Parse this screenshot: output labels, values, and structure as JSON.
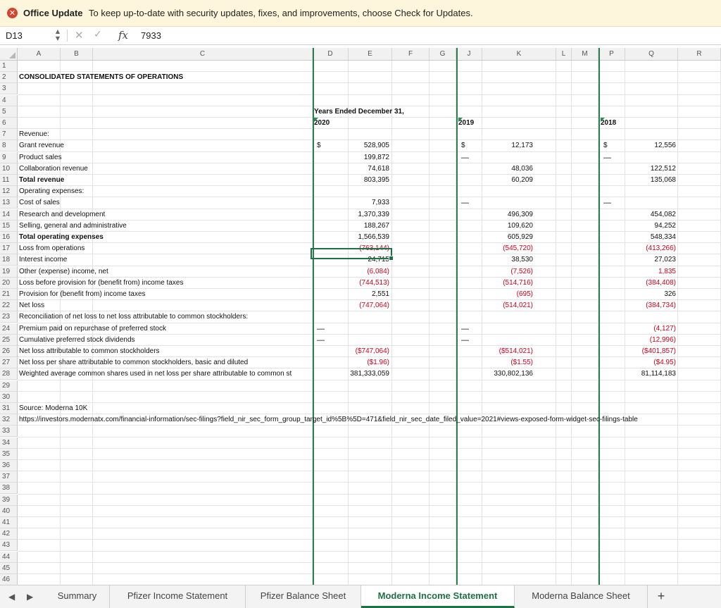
{
  "notification": {
    "title": "Office Update",
    "message": "To keep up-to-date with security updates, fixes, and improvements, choose Check for Updates."
  },
  "formula_bar": {
    "name_box": "D13",
    "fx": "fx",
    "value": "7933"
  },
  "columns": [
    "A",
    "B",
    "C",
    "D",
    "E",
    "F",
    "G",
    "J",
    "K",
    "L",
    "M",
    "P",
    "Q",
    "R"
  ],
  "rows": [
    "1",
    "2",
    "3",
    "4",
    "5",
    "6",
    "7",
    "8",
    "9",
    "10",
    "11",
    "12",
    "13",
    "14",
    "15",
    "16",
    "17",
    "18",
    "19",
    "20",
    "21",
    "22",
    "23",
    "24",
    "25",
    "26",
    "27",
    "28",
    "29",
    "30",
    "31",
    "32",
    "33",
    "34",
    "35",
    "36",
    "37",
    "38",
    "39",
    "40",
    "41",
    "42",
    "43",
    "44",
    "45",
    "46"
  ],
  "sheet": {
    "title": "CONSOLIDATED STATEMENTS OF OPERATIONS",
    "period_header": "Years Ended December 31,",
    "years": [
      "2020",
      "2019",
      "2018"
    ],
    "currency": "$",
    "dash": "—",
    "labels": {
      "revenue": "Revenue:",
      "grant_revenue": "Grant revenue",
      "product_sales": "Product sales",
      "collab_revenue": "Collaboration revenue",
      "total_revenue": "Total revenue",
      "operating_expenses": "Operating expenses:",
      "cost_of_sales": "Cost of sales",
      "rnd": "Research and development",
      "sga": "Selling, general and administrative",
      "total_opex": "Total operating expenses",
      "loss_ops": "Loss from operations",
      "interest_income": "Interest income",
      "other_income": "Other (expense) income, net",
      "loss_before_tax": "Loss before provision for (benefit from) income taxes",
      "provision": "Provision for (benefit from) income taxes",
      "net_loss": "Net loss",
      "reconciliation": "Reconciliation of net loss to net loss attributable to common stockholders:",
      "premium_paid": "Premium paid on repurchase of preferred stock",
      "cumulative_div": "Cumulative preferred stock dividends",
      "net_loss_attr": "Net loss attributable to common stockholders",
      "eps": "Net loss per share attributable to common stockholders, basic and diluted",
      "weighted": "Weighted average common shares used in net loss per share attributable to common st",
      "source": "Source: Moderna 10K",
      "url": "https://investors.modernatx.com/financial-information/sec-filings?field_nir_sec_form_group_target_id%5B%5D=471&field_nir_sec_date_filed_value=2021#views-exposed-form-widget-sec-filings-table"
    },
    "y2020": {
      "grant_revenue": "528,905",
      "product_sales": "199,872",
      "collab_revenue": "74,618",
      "total_revenue": "803,395",
      "cost_of_sales": "7,933",
      "rnd": "1,370,339",
      "sga": "188,267",
      "total_opex": "1,566,539",
      "loss_ops": "(763,144)",
      "interest_income": "24,715",
      "other_income": "(6,084)",
      "loss_before_tax": "(744,513)",
      "provision": "2,551",
      "net_loss": "(747,064)",
      "net_loss_attr": "($747,064)",
      "eps": "($1.96)",
      "weighted": "381,333,059"
    },
    "y2019": {
      "grant_revenue": "12,173",
      "collab_revenue": "48,036",
      "total_revenue": "60,209",
      "rnd": "496,309",
      "sga": "109,620",
      "total_opex": "605,929",
      "loss_ops": "(545,720)",
      "interest_income": "38,530",
      "other_income": "(7,526)",
      "loss_before_tax": "(514,716)",
      "provision": "(695)",
      "net_loss": "(514,021)",
      "net_loss_attr": "($514,021)",
      "eps": "($1.55)",
      "weighted": "330,802,136"
    },
    "y2018": {
      "grant_revenue": "12,556",
      "collab_revenue": "122,512",
      "total_revenue": "135,068",
      "rnd": "454,082",
      "sga": "94,252",
      "total_opex": "548,334",
      "loss_ops": "(413,266)",
      "interest_income": "27,023",
      "other_income": "1,835",
      "loss_before_tax": "(384,408)",
      "provision": "326",
      "net_loss": "(384,734)",
      "premium_paid": "(4,127)",
      "cumulative_div": "(12,996)",
      "net_loss_attr": "($401,857)",
      "eps": "($4.95)",
      "weighted": "81,114,183"
    }
  },
  "tabs": [
    "Summary",
    "Pfizer Income Statement",
    "Pfizer Balance Sheet",
    "Moderna Income Statement",
    "Moderna Balance Sheet"
  ],
  "tab_nav": {
    "prev": "◀",
    "next": "▶",
    "add": "+"
  },
  "colors": {
    "accent": "#1e7145",
    "negative": "#d0021b",
    "notify_bg": "#fdf6dc"
  }
}
